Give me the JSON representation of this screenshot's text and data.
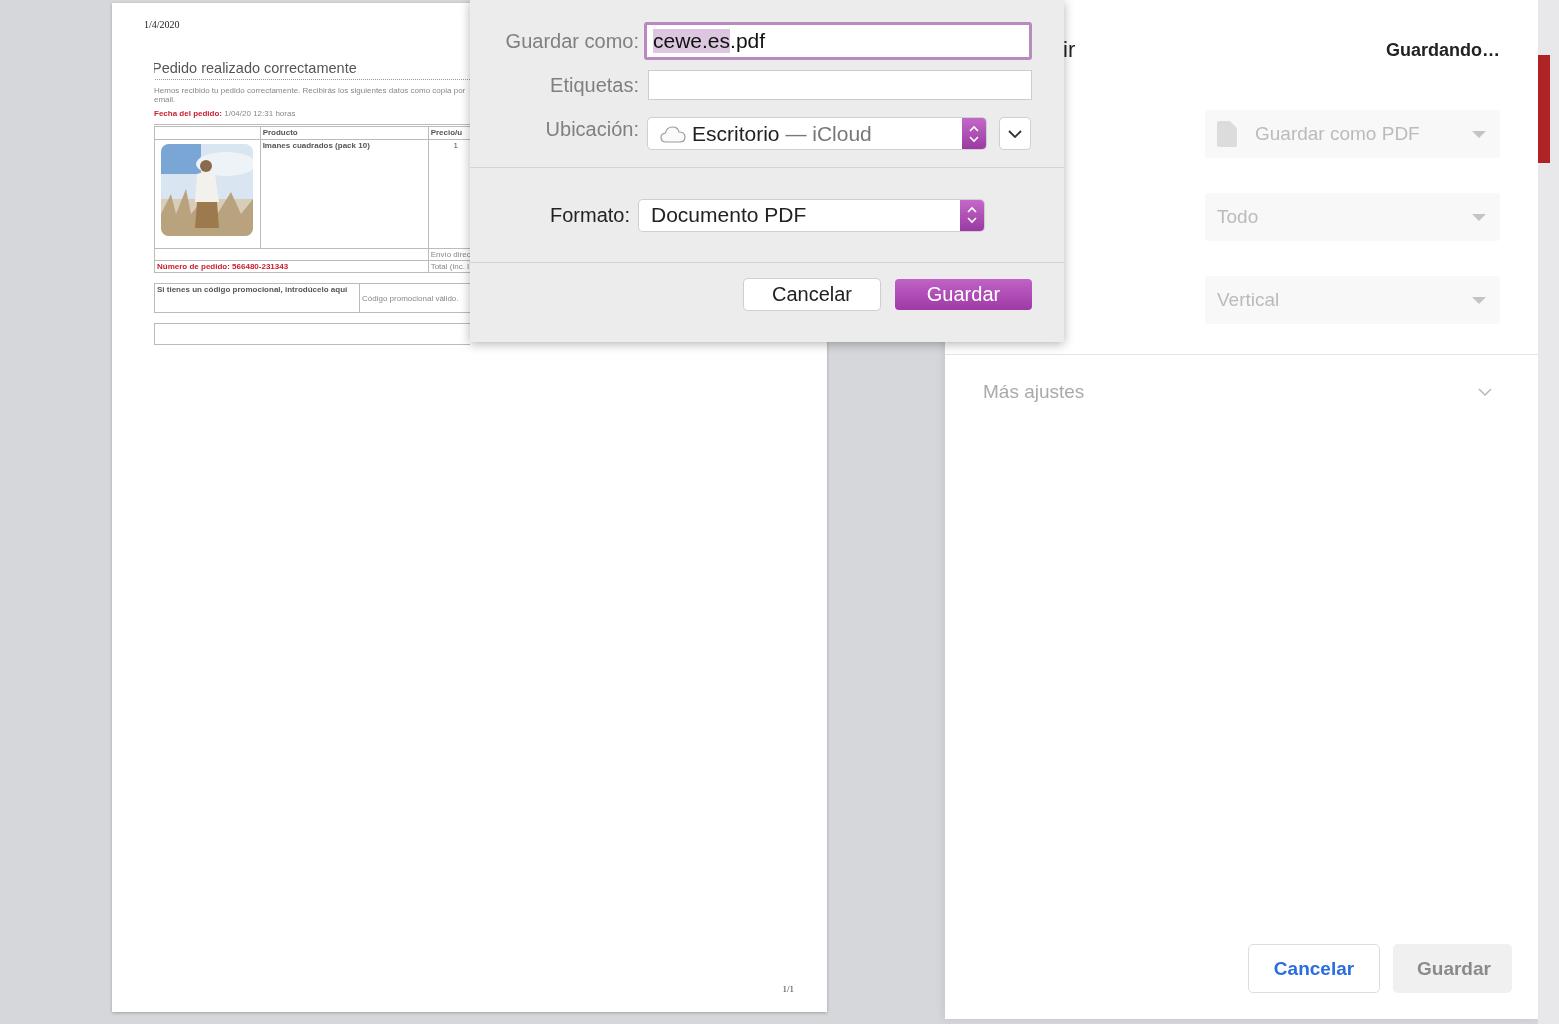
{
  "document": {
    "date": "1/4/2020",
    "title": "Pedido realizado correctamente",
    "intro": "Hemos recibido tu pedido correctamente. Recibirás los siguientes datos como copia por email.",
    "order_date": "**Fecha del pedido:** 1/04/20 12:31 horas",
    "table": {
      "columns": [
        "Producto",
        "Precio/u"
      ],
      "product": "Imanes cuadrados (pack 10)",
      "quantity": "1",
      "shipping": "Envío direc",
      "order_number": "Número de pedido: 566480-231343",
      "total": "Total (inc. I"
    },
    "promo_prompt": "Si tienes un código promocional, introdúcelo aquí",
    "promo_status": "Código promocional válido.",
    "page_number": "1/1"
  },
  "save_dialog": {
    "name_field": {
      "label": "Guardar como:",
      "selected_text": "cewe.es",
      "rest_text": ".pdf",
      "focused": true
    },
    "tags_field": {
      "label": "Etiquetas:"
    },
    "location": {
      "label": "Ubicación:",
      "value": "Escritorio",
      "detail": "— iCloud",
      "expanded": false
    },
    "format": {
      "label": "Formato:",
      "value": "Documento PDF"
    },
    "buttons": [
      {
        "label": "Cancelar",
        "kind": "secondary"
      },
      {
        "label": "Guardar",
        "kind": "primary"
      }
    ]
  },
  "print_panel": {
    "title": "ir",
    "status": "Guardando…",
    "settings": [
      {
        "kind": "destination",
        "value": "Guardar como PDF"
      },
      {
        "kind": "select",
        "value": "Todo"
      },
      {
        "kind": "select",
        "value": "Vertical"
      }
    ],
    "more_settings": {
      "label": "Más ajustes",
      "expanded": false
    },
    "buttons": [
      {
        "label": "Cancelar",
        "kind": "secondary",
        "disabled": false
      },
      {
        "label": "Guardar",
        "kind": "primary",
        "disabled": true
      }
    ]
  }
}
